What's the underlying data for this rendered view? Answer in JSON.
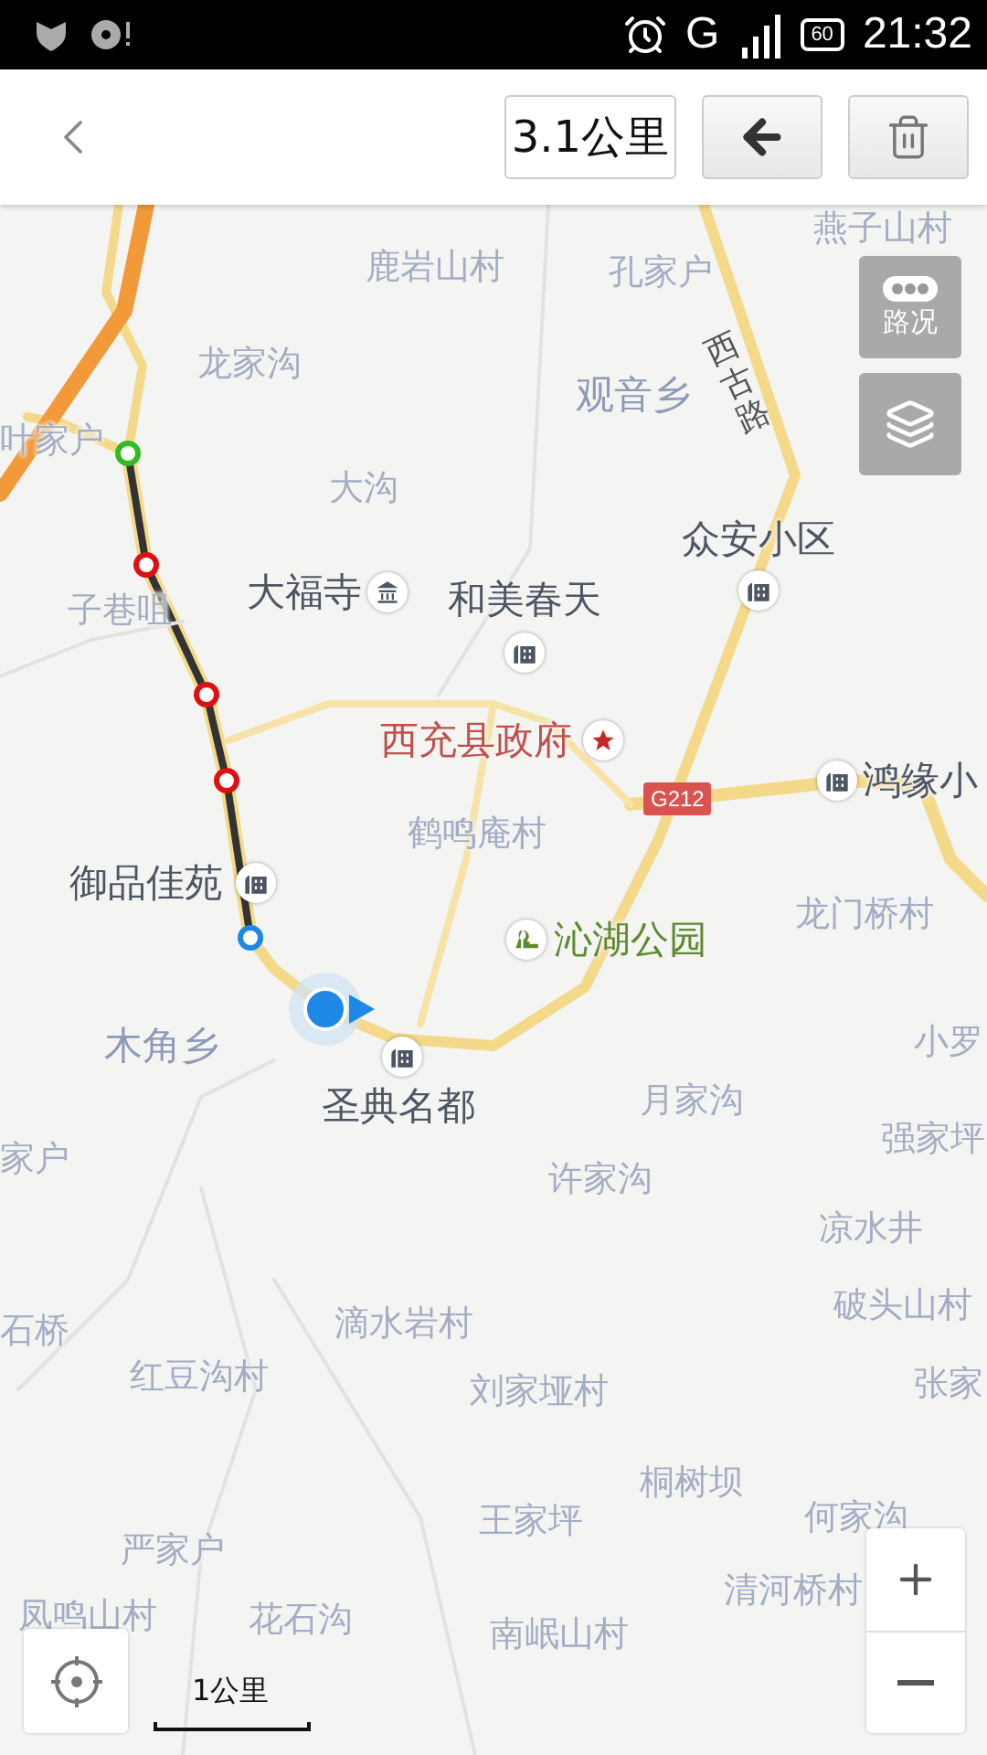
{
  "status_bar": {
    "network": "G",
    "battery": "60",
    "time": "21:32"
  },
  "toolbar": {
    "distance": "3.1公里"
  },
  "map": {
    "labels": [
      {
        "text": "燕子山村",
        "kind": "village"
      },
      {
        "text": "鹿岩山村",
        "kind": "village"
      },
      {
        "text": "孔家户",
        "kind": "village"
      },
      {
        "text": "西古路",
        "kind": "road"
      },
      {
        "text": "龙家沟",
        "kind": "village"
      },
      {
        "text": "观音乡",
        "kind": "town"
      },
      {
        "text": "叶家户",
        "kind": "village"
      },
      {
        "text": "大沟",
        "kind": "village"
      },
      {
        "text": "众安小区",
        "kind": "poi"
      },
      {
        "text": "子巷咀",
        "kind": "village"
      },
      {
        "text": "大福寺",
        "kind": "temple"
      },
      {
        "text": "和美春天",
        "kind": "poi"
      },
      {
        "text": "西充县政府",
        "kind": "government"
      },
      {
        "text": "G212",
        "kind": "shield"
      },
      {
        "text": "鸿缘小",
        "kind": "poi"
      },
      {
        "text": "鹤鸣庵村",
        "kind": "village"
      },
      {
        "text": "御品佳苑",
        "kind": "poi"
      },
      {
        "text": "龙门桥村",
        "kind": "village"
      },
      {
        "text": "沁湖公园",
        "kind": "park"
      },
      {
        "text": "小罗",
        "kind": "village"
      },
      {
        "text": "木角乡",
        "kind": "town"
      },
      {
        "text": "圣典名都",
        "kind": "poi"
      },
      {
        "text": "月家沟",
        "kind": "village"
      },
      {
        "text": "强家坪",
        "kind": "village"
      },
      {
        "text": "家户",
        "kind": "village"
      },
      {
        "text": "许家沟",
        "kind": "village"
      },
      {
        "text": "凉水井",
        "kind": "village"
      },
      {
        "text": "破头山村",
        "kind": "village"
      },
      {
        "text": "石桥",
        "kind": "village"
      },
      {
        "text": "滴水岩村",
        "kind": "village"
      },
      {
        "text": "红豆沟村",
        "kind": "village"
      },
      {
        "text": "刘家垭村",
        "kind": "village"
      },
      {
        "text": "张家",
        "kind": "village"
      },
      {
        "text": "桐树坝",
        "kind": "village"
      },
      {
        "text": "王家坪",
        "kind": "village"
      },
      {
        "text": "何家沟",
        "kind": "village"
      },
      {
        "text": "严家户",
        "kind": "village"
      },
      {
        "text": "清河桥村",
        "kind": "village"
      },
      {
        "text": "凤鸣山村",
        "kind": "village"
      },
      {
        "text": "花石沟",
        "kind": "village"
      },
      {
        "text": "南岷山村",
        "kind": "village"
      }
    ],
    "waypoints": [
      {
        "color": "#33bb22"
      },
      {
        "color": "#dd1111"
      },
      {
        "color": "#dd1111"
      },
      {
        "color": "#dd1111"
      },
      {
        "color": "#1e88e5"
      }
    ],
    "traffic_button": "路况",
    "scale": "1公里"
  }
}
